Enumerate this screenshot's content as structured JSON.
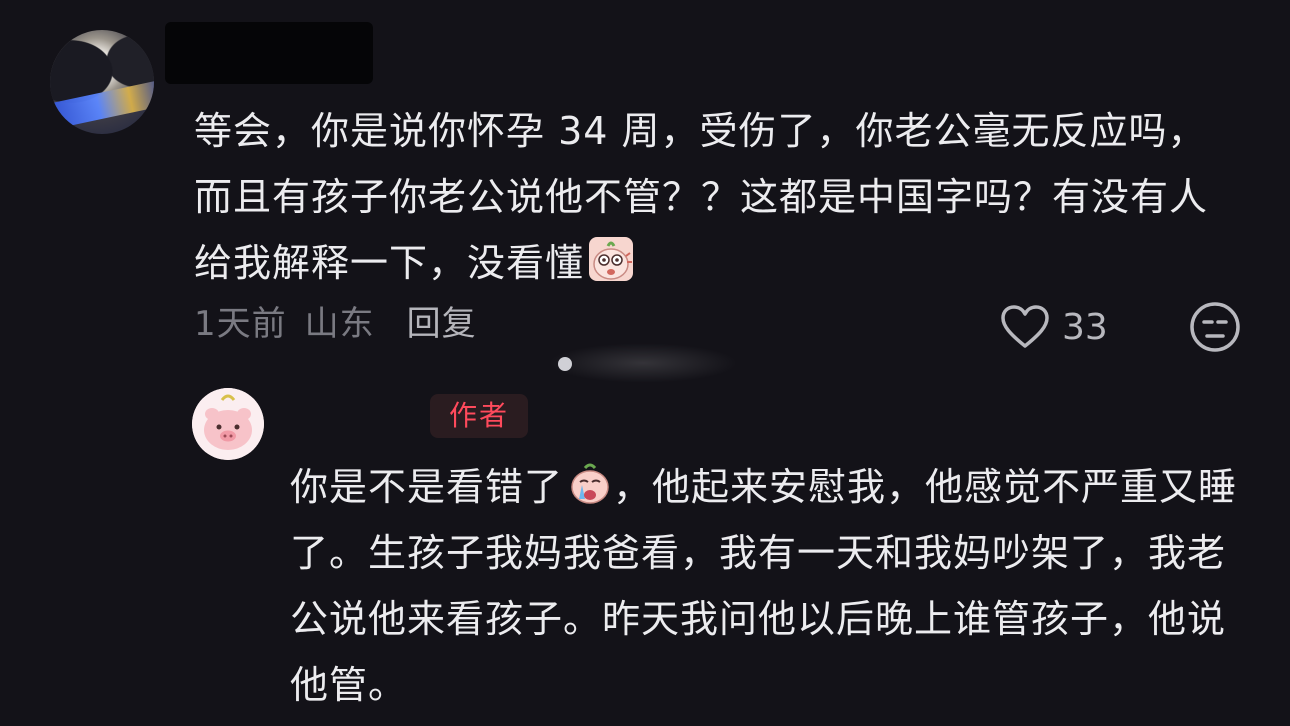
{
  "comment": {
    "username": "",
    "text": "等会，你是说你怀孕 34 周，受伤了，你老公毫无反应吗，而且有孩子你老公说他不管？？这都是中国字吗？有没有人给我解释一下，没看懂",
    "sticker_icon": "confused-face-sticker",
    "time": "1天前",
    "location": "山东",
    "reply_label": "回复",
    "like_count": "33",
    "like_icon": "heart-outline-icon",
    "dislike_icon": "unhappy-face-icon"
  },
  "reply": {
    "username": "",
    "author_badge": "作者",
    "text_part1": "你是不是看错了",
    "sticker_icon": "crying-face-sticker",
    "text_part2": "，他起来安慰我，他感觉不严重又睡了。生孩子我妈我爸看，我有一天和我妈吵架了，我老公说他来看孩子。昨天我问他以后晚上谁管孩子，他说他管。"
  },
  "colors": {
    "background": "#131218",
    "text": "#ececef",
    "meta": "#7a7a82",
    "author_badge": "#ff4a5c"
  }
}
